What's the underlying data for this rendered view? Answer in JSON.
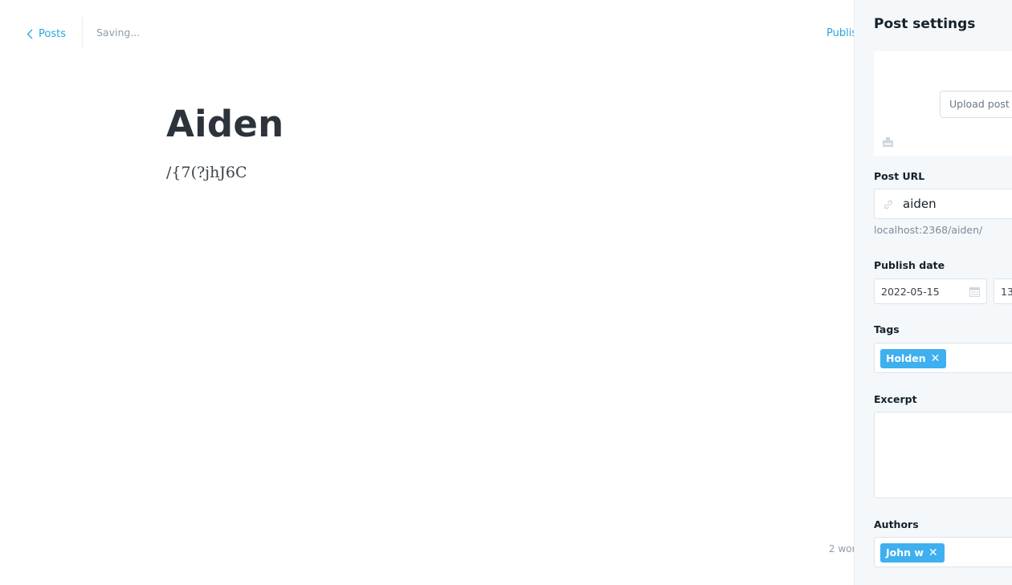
{
  "topbar": {
    "back_label": "Posts",
    "save_status": "Saving...",
    "publish_label": "Publis"
  },
  "post": {
    "title": "Aiden",
    "body": "/{7(?jhJ6C",
    "word_count": "2 wor"
  },
  "settings": {
    "title": "Post settings",
    "upload_label": "Upload post image",
    "url_label": "Post URL",
    "url_value": "aiden",
    "url_preview": "localhost:2368/aiden/",
    "publish_date_label": "Publish date",
    "publish_date": "2022-05-15",
    "publish_time": "13",
    "tags_label": "Tags",
    "tags": [
      "Holden"
    ],
    "excerpt_label": "Excerpt",
    "excerpt_value": "",
    "authors_label": "Authors",
    "authors": [
      "John w"
    ]
  },
  "icons": {
    "back": "chevron-left-icon",
    "link": "link-icon",
    "calendar": "calendar-icon",
    "image": "image-placeholder-icon",
    "remove": "close-icon"
  },
  "colors": {
    "accent": "#2ba5de",
    "chip": "#3eb0ef",
    "panel_bg": "#f4f8fb"
  }
}
